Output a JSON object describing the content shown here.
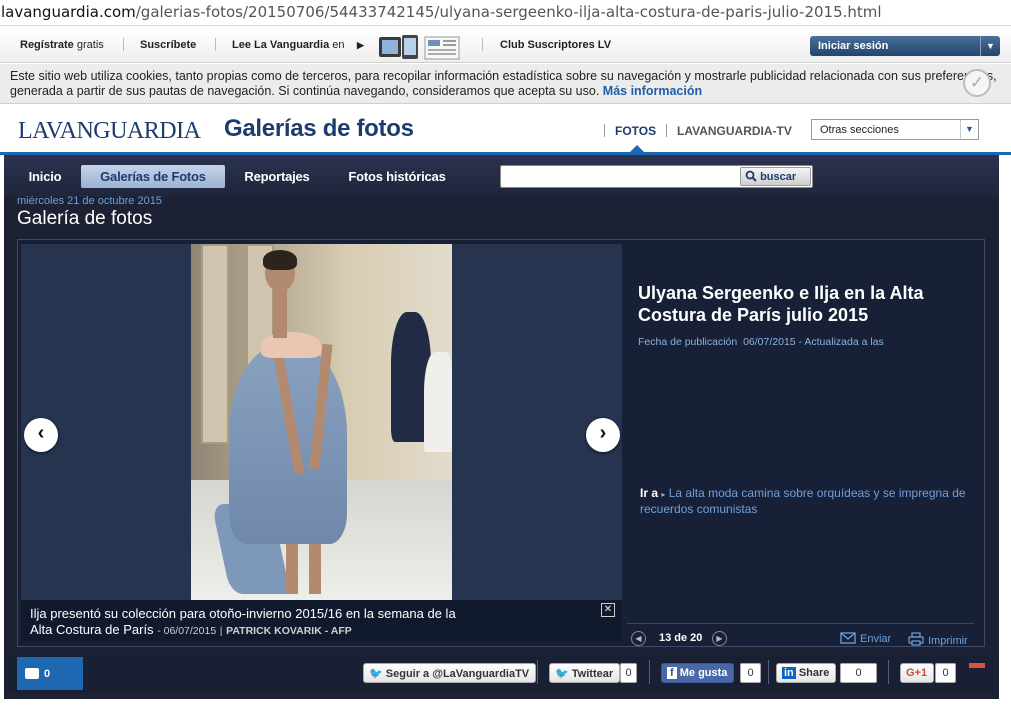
{
  "browser": {
    "url_domain": "lavanguardia.com",
    "url_path": "/galerias-fotos/20150706/54433742145/ulyana-sergeenko-ilja-alta-costura-de-paris-julio-2015.html"
  },
  "topbar": {
    "register_bold": "Regístrate",
    "register_thin": "gratis",
    "subscribe": "Suscríbete",
    "read_lv": "Lee La Vanguardia",
    "read_lv_suffix": "en",
    "club": "Club Suscriptores LV",
    "login": "Iniciar sesión"
  },
  "cookie": {
    "text": "Este sitio web utiliza cookies, tanto propias como de terceros, para recopilar información estadística sobre su navegación y mostrarle publicidad relacionada con sus preferencias, generada a partir de sus pautas de navegación. Si continúa navegando, consideramos que acepta su uso.",
    "more": "Más información"
  },
  "header": {
    "logo": "LAVANGUARDIA",
    "section": "Galerías de fotos",
    "nav_fotos": "FOTOS",
    "nav_tv": "LAVANGUARDIA-TV",
    "other_sections": "Otras secciones"
  },
  "nav": {
    "items": [
      "Inicio",
      "Galerías de Fotos",
      "Reportajes",
      "Fotos históricas"
    ],
    "search_placeholder": "",
    "search_button": "buscar"
  },
  "gallery": {
    "date": "miércoles 21 de octubre 2015",
    "title": "Galería de fotos",
    "caption_line1": "Ilja presentó su colección para otoño-invierno 2015/16 en la semana de la",
    "caption_line2": "Alta Costura de París",
    "caption_date": "- 06/07/2015",
    "caption_sep": "|",
    "caption_credit": "PATRICK KOVARIK - AFP",
    "close": "✕",
    "prev": "‹",
    "next": "›"
  },
  "side": {
    "title": "Ulyana Sergeenko e Ilja en la Alta Costura de París julio 2015",
    "pub_label": "Fecha de publicación",
    "pub_date": "06/07/2015 - Actualizada a las",
    "goto_label": "Ir a",
    "goto_link": "La alta moda camina sobre orquídeas y se impregna de recuerdos comunistas",
    "pager": "13 de 20",
    "send": "Enviar",
    "print": "Imprimir"
  },
  "share": {
    "comments_count": "0",
    "follow": "Seguir a @LaVanguardiaTV",
    "twitter": "Twittear",
    "twitter_count": "0",
    "fb": "Me gusta",
    "fb_count": "0",
    "linkedin": "Share",
    "linkedin_count": "0",
    "gplus": "G+1",
    "gplus_count": "0"
  },
  "colors": {
    "brand_blue": "#1d3c6e",
    "accent_blue": "#1e68b1",
    "dark_bg": "#1c2133",
    "link_blue": "#6fa0dd"
  }
}
